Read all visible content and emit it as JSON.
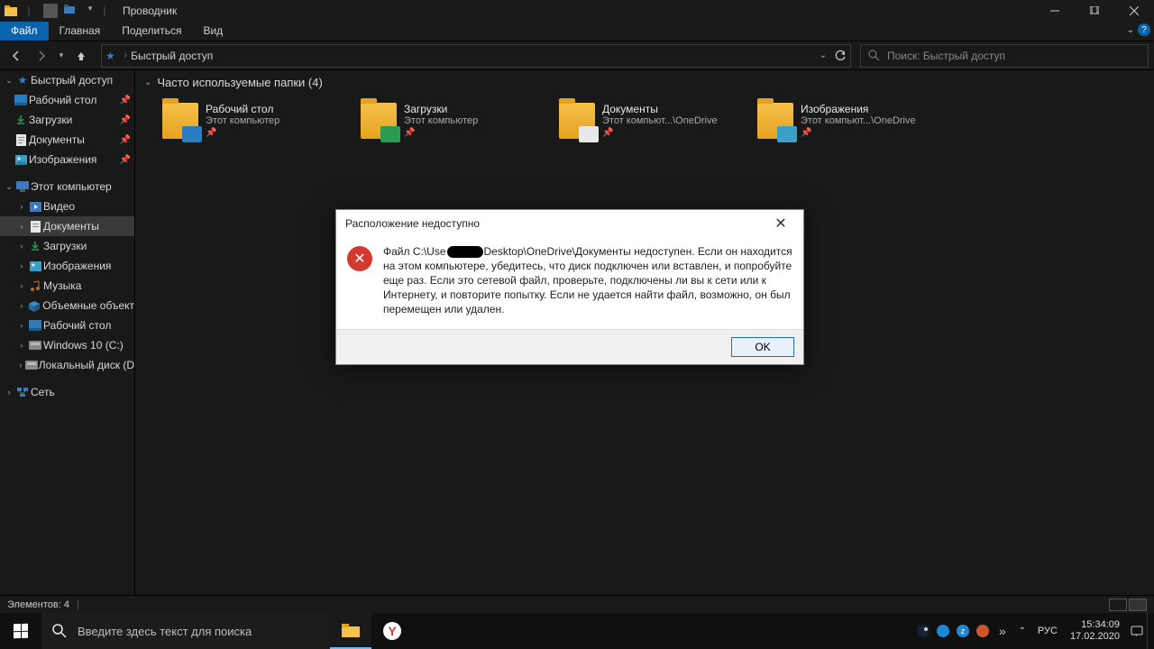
{
  "window": {
    "title": "Проводник"
  },
  "ribbon": {
    "file": "Файл",
    "tabs": [
      "Главная",
      "Поделиться",
      "Вид"
    ]
  },
  "address": {
    "location": "Быстрый доступ",
    "search_placeholder": "Поиск: Быстрый доступ"
  },
  "sidebar": {
    "quick_access": "Быстрый доступ",
    "quick_items": [
      {
        "label": "Рабочий стол"
      },
      {
        "label": "Загрузки"
      },
      {
        "label": "Документы"
      },
      {
        "label": "Изображения"
      }
    ],
    "this_pc": "Этот компьютер",
    "pc_items": [
      {
        "label": "Видео"
      },
      {
        "label": "Документы",
        "selected": true
      },
      {
        "label": "Загрузки"
      },
      {
        "label": "Изображения"
      },
      {
        "label": "Музыка"
      },
      {
        "label": "Объемные объект"
      },
      {
        "label": "Рабочий стол"
      },
      {
        "label": "Windows 10 (C:)"
      },
      {
        "label": "Локальный диск (D"
      }
    ],
    "network": "Сеть"
  },
  "content": {
    "group_title": "Часто используемые папки (4)",
    "folders": [
      {
        "name": "Рабочий стол",
        "sub": "Этот компьютер"
      },
      {
        "name": "Загрузки",
        "sub": "Этот компьютер"
      },
      {
        "name": "Документы",
        "sub": "Этот компьют...\\OneDrive"
      },
      {
        "name": "Изображения",
        "sub": "Этот компьют...\\OneDrive"
      }
    ]
  },
  "statusbar": {
    "text": "Элементов: 4"
  },
  "dialog": {
    "title": "Расположение недоступно",
    "text_pre": "Файл C:\\Use",
    "text_post": "Desktop\\OneDrive\\Документы недоступен. Если он находится на этом компьютере, убедитесь, что диск подключен или вставлен, и попробуйте еще раз. Если это сетевой файл, проверьте, подключены ли вы к сети или к Интернету, и повторите попытку. Если не удается найти файл, возможно, он был перемещен или удален.",
    "ok": "OK"
  },
  "taskbar": {
    "search_placeholder": "Введите здесь текст для поиска",
    "lang": "РУС",
    "time": "15:34:09",
    "date": "17.02.2020"
  }
}
